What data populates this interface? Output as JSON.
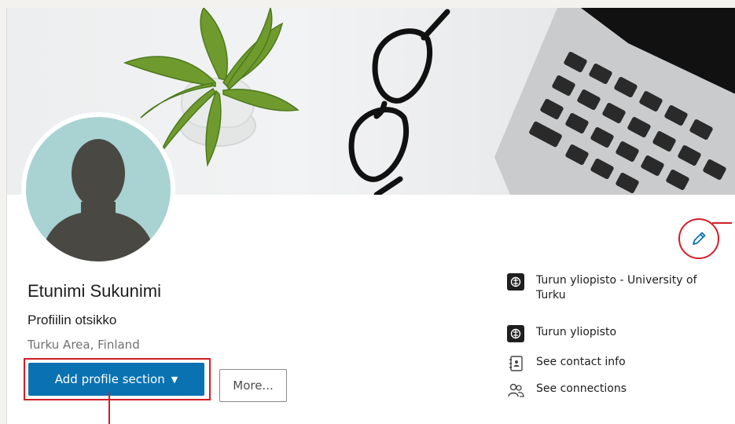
{
  "profile": {
    "name": "Etunimi Sukunimi",
    "headline": "Profiilin otsikko",
    "location": "Turku Area, Finland"
  },
  "actions": {
    "add_section_label": "Add profile section",
    "add_section_caret": "▼",
    "more_label": "More..."
  },
  "sidebar": {
    "items": [
      {
        "label": "Turun yliopisto - University of Turku",
        "icon": "university-logo-icon"
      },
      {
        "label": "Turun yliopisto",
        "icon": "university-logo-icon"
      },
      {
        "label": "See contact info",
        "icon": "contact-card-icon"
      },
      {
        "label": "See connections",
        "icon": "people-icon"
      }
    ]
  },
  "colors": {
    "primary_button": "#0a72b1",
    "annotation": "#d11f26",
    "avatar_bg": "#a9d2d2"
  }
}
